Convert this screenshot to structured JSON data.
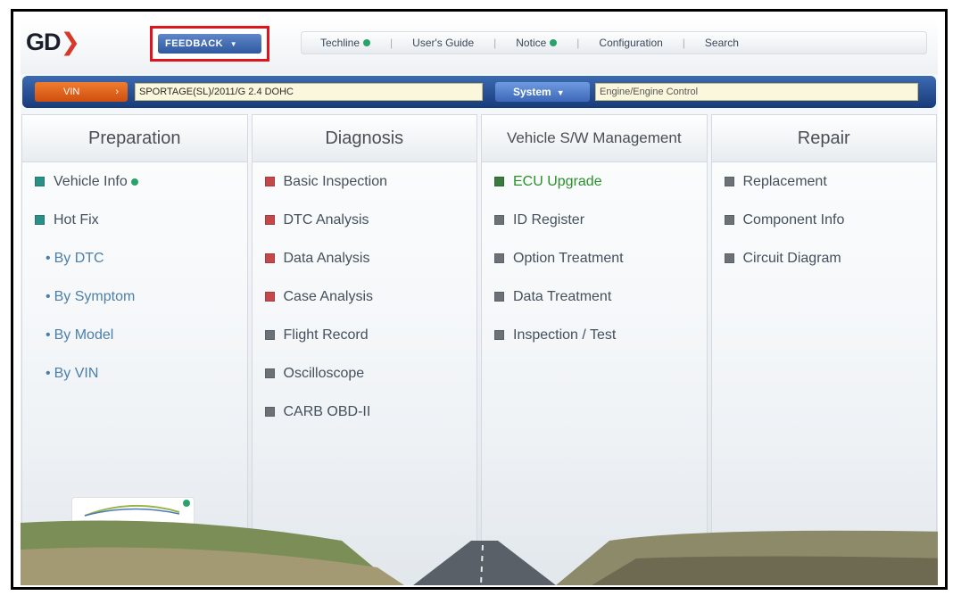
{
  "header": {
    "logo": "GD",
    "feedback_label": "FEEDBACK",
    "menu": {
      "techline": "Techline",
      "users_guide": "User's Guide",
      "notice": "Notice",
      "configuration": "Configuration",
      "search": "Search"
    }
  },
  "vinbar": {
    "vin_label": "VIN",
    "vin_value": "SPORTAGE(SL)/2011/G 2.4 DOHC",
    "system_label": "System",
    "system_value": "Engine/Engine Control"
  },
  "columns": {
    "preparation": {
      "title": "Preparation",
      "items": [
        "Vehicle Info",
        "Hot Fix"
      ],
      "subitems": [
        "By DTC",
        "By Symptom",
        "By Model",
        "By VIN"
      ]
    },
    "diagnosis": {
      "title": "Diagnosis",
      "items": [
        "Basic Inspection",
        "DTC Analysis",
        "Data Analysis",
        "Case Analysis",
        "Flight Record",
        "Oscilloscope",
        "CARB OBD-II"
      ]
    },
    "vehicle_sw": {
      "title": "Vehicle S/W Management",
      "items": [
        "ECU Upgrade",
        "ID Register",
        "Option Treatment",
        "Data Treatment",
        "Inspection / Test"
      ]
    },
    "repair": {
      "title": "Repair",
      "items": [
        "Replacement",
        "Component Info",
        "Circuit Diagram"
      ]
    }
  },
  "colors": {
    "accent_blue": "#2f589f",
    "highlight_red": "#e0141c",
    "vin_orange": "#cf4e0e",
    "ecu_green": "#2c8f2c"
  },
  "icons": {
    "status": "green-dot-icon",
    "bullet": "square-bullet-icon",
    "dropdown": "chevron-down-icon"
  }
}
